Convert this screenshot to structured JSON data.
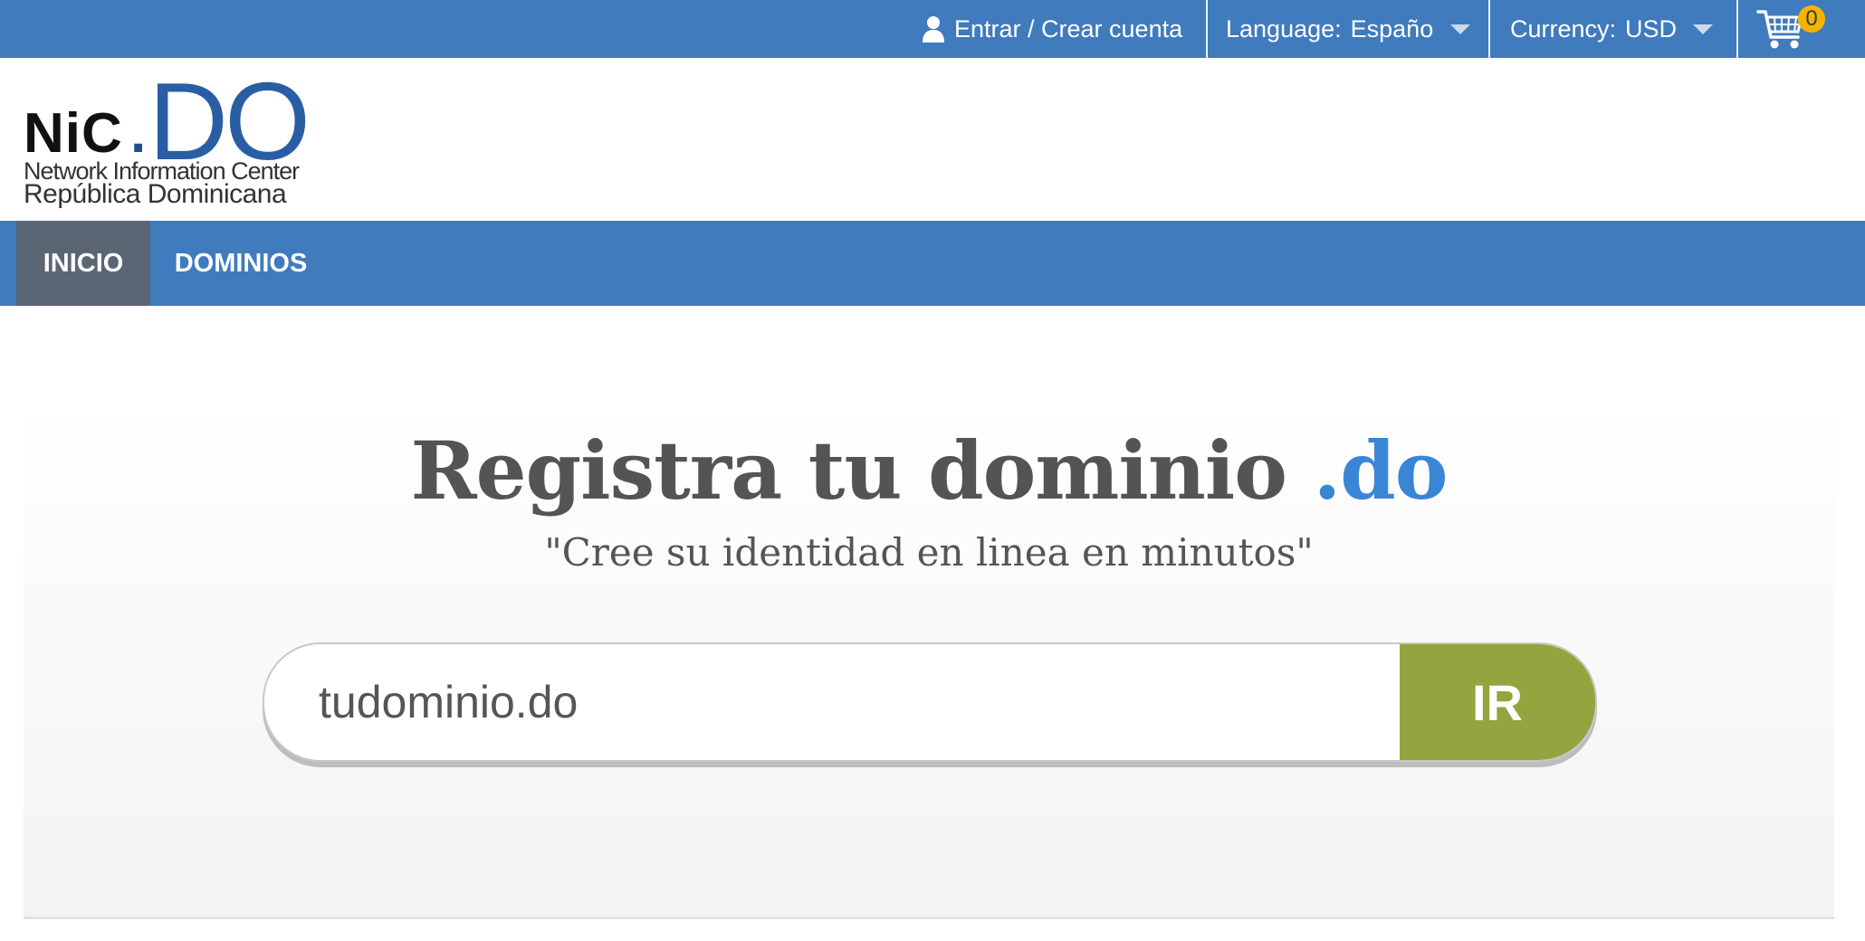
{
  "topbar": {
    "login_label": "Entrar / Crear cuenta",
    "language_label": "Language:",
    "language_value": "Españo",
    "currency_label": "Currency:",
    "currency_value": "USD",
    "cart_count": "0",
    "background_color": "#3f7bbd"
  },
  "logo": {
    "nic": "NiC",
    "dot": ".",
    "do": "DO",
    "line1": "Network Information Center",
    "line2": "República Dominicana"
  },
  "nav": {
    "items": [
      {
        "label": "INICIO",
        "active": true
      },
      {
        "label": "DOMINIOS",
        "active": false
      }
    ],
    "active_color": "#5a6673"
  },
  "hero": {
    "title": "Registra tu dominio ",
    "title_accent": ".do",
    "subtitle": "\"Cree su identidad en linea en minutos\"",
    "search_value": "tudominio.do",
    "search_button": "IR",
    "button_color": "#93a53e",
    "accent_color": "#3a86d6"
  },
  "icons": {
    "user": "user-icon",
    "cart": "cart-icon",
    "caret": "chevron-down-icon"
  }
}
